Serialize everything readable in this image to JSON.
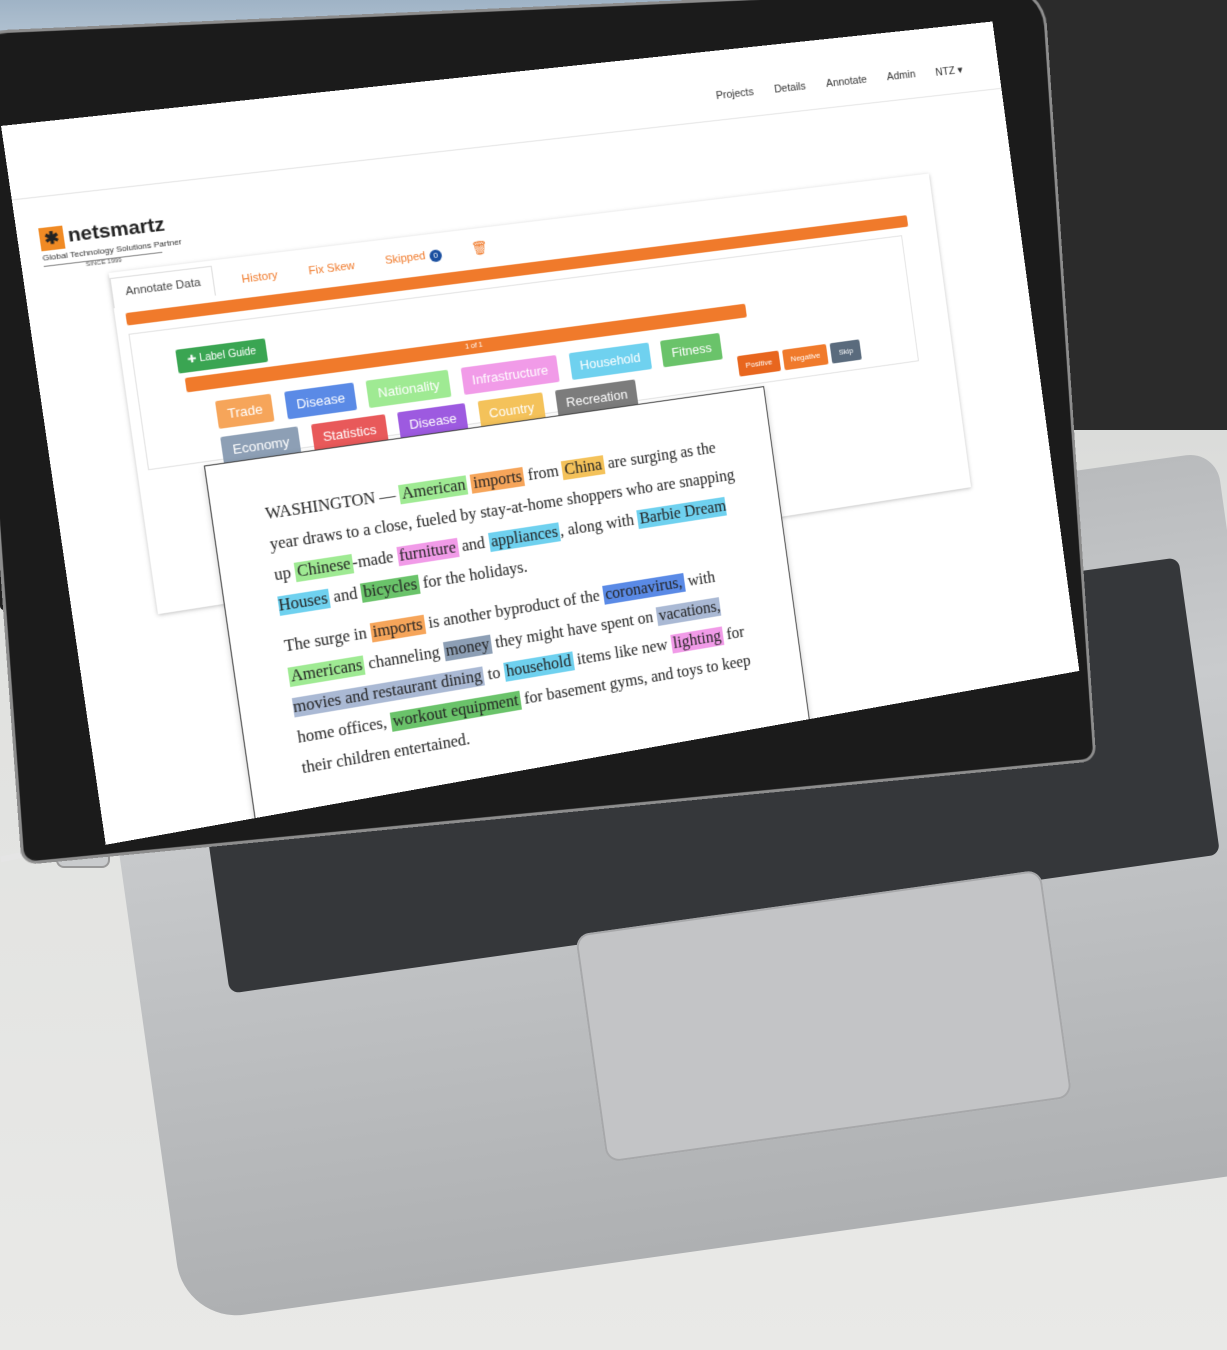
{
  "navbar": {
    "items": [
      "Projects",
      "Details",
      "Annotate",
      "Admin",
      "NTZ ▾"
    ]
  },
  "brand": {
    "name": "netsmartz",
    "tagline": "Global Technology Solutions Partner",
    "since": "SINCE 1999"
  },
  "tabs": {
    "annotate": "Annotate Data",
    "history": "History",
    "fix_skew": "Fix Skew",
    "skipped": "Skipped",
    "skipped_count": "0"
  },
  "toolbar": {
    "label_guide": "Label Guide",
    "progress_text": "1 of 1"
  },
  "labels": [
    {
      "text": "Trade",
      "color": "#f6a55a"
    },
    {
      "text": "Disease",
      "color": "#5a8ae6"
    },
    {
      "text": "Nationality",
      "color": "#9fea93"
    },
    {
      "text": "Infrastructure",
      "color": "#f19be8"
    },
    {
      "text": "Household",
      "color": "#6fd1ef"
    },
    {
      "text": "Fitness",
      "color": "#6ac36a"
    },
    {
      "text": "Economy",
      "color": "#8d9fb5"
    },
    {
      "text": "Statistics",
      "color": "#e8595a"
    },
    {
      "text": "Disease",
      "color": "#9d5ae0"
    },
    {
      "text": "Country",
      "color": "#f4c25a"
    },
    {
      "text": "Recreation",
      "color": "#7c7c7c"
    }
  ],
  "decisions": {
    "positive": "Positive",
    "negative": "Negative",
    "skip": "Skip"
  },
  "document": {
    "p1": [
      {
        "t": "WASHINGTON — "
      },
      {
        "t": "American",
        "c": "#9fea93"
      },
      {
        "t": " "
      },
      {
        "t": "imports",
        "c": "#f6a55a"
      },
      {
        "t": " from "
      },
      {
        "t": "China",
        "c": "#f4c25a"
      },
      {
        "t": " are surging as the year draws to a close, fueled by stay-at-home shoppers who are snapping up "
      },
      {
        "t": "Chinese",
        "c": "#9fea93"
      },
      {
        "t": "-made "
      },
      {
        "t": "furniture",
        "c": "#f19be8"
      },
      {
        "t": " and "
      },
      {
        "t": "appliances",
        "c": "#6fd1ef"
      },
      {
        "t": ", along with "
      },
      {
        "t": "Barbie Dream Houses",
        "c": "#6fd1ef"
      },
      {
        "t": " and "
      },
      {
        "t": "bicycles",
        "c": "#6ac36a"
      },
      {
        "t": " for the holidays."
      }
    ],
    "p2": [
      {
        "t": "The surge in "
      },
      {
        "t": "imports",
        "c": "#f6a55a"
      },
      {
        "t": " is another byproduct of the "
      },
      {
        "t": "coronavirus,",
        "c": "#5a8ae6"
      },
      {
        "t": " with "
      },
      {
        "t": "Americans",
        "c": "#9fea93"
      },
      {
        "t": " channeling "
      },
      {
        "t": "money",
        "c": "#8d9fb5"
      },
      {
        "t": " they might have spent on "
      },
      {
        "t": "vacations, movies and restaurant dining",
        "c": "#aab9d4"
      },
      {
        "t": " to "
      },
      {
        "t": "household",
        "c": "#6fd1ef"
      },
      {
        "t": " items like new "
      },
      {
        "t": "lighting",
        "c": "#f19be8"
      },
      {
        "t": " for home offices, "
      },
      {
        "t": "workout equipment",
        "c": "#6ac36a"
      },
      {
        "t": " for basement gyms, and toys to keep their children entertained."
      }
    ]
  },
  "colors": {
    "accent_orange": "#f07a2b",
    "guide_green": "#3aa552",
    "positive": "#e8661e",
    "negative": "#f07a2b",
    "skip": "#5a6b7d"
  }
}
